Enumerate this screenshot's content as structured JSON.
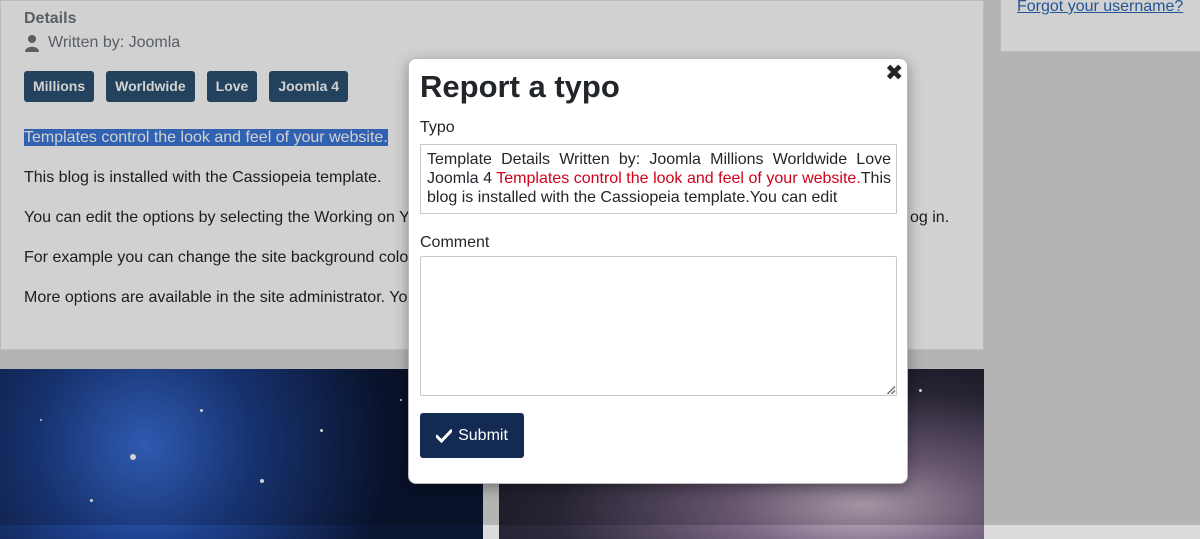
{
  "article": {
    "details_title": "Details",
    "written_by": "Written by: Joomla",
    "tags": [
      "Millions",
      "Worldwide",
      "Love",
      "Joomla 4"
    ],
    "paragraphs": [
      "Templates control the look and feel of your website.",
      "This blog is installed with the Cassiopeia template.",
      "You can edit the options by selecting the Working on Y",
      "For example you can change the site background colo",
      "More options are available in the site administrator. Yo"
    ],
    "paragraph3_tail": "og in."
  },
  "sidebar": {
    "forgot_username": "Forgot your username?"
  },
  "modal": {
    "title": "Report a typo",
    "close_symbol": "✖",
    "typo_label": "Typo",
    "typo_text_before": "Template Details Written by: Joomla Millions Worldwide Love Joomla 4 ",
    "typo_text_highlight": "Templates control the look and feel of your website.",
    "typo_text_after": "This blog is installed with the Cassiopeia template.You can edit",
    "comment_label": "Comment",
    "comment_value": "",
    "submit_label": "Submit"
  },
  "colors": {
    "tag_bg": "#2b5172",
    "submit_bg": "#132a52",
    "highlight_text": "#d0021b",
    "selection_bg": "#3c78d8",
    "link": "#2a69b8"
  }
}
